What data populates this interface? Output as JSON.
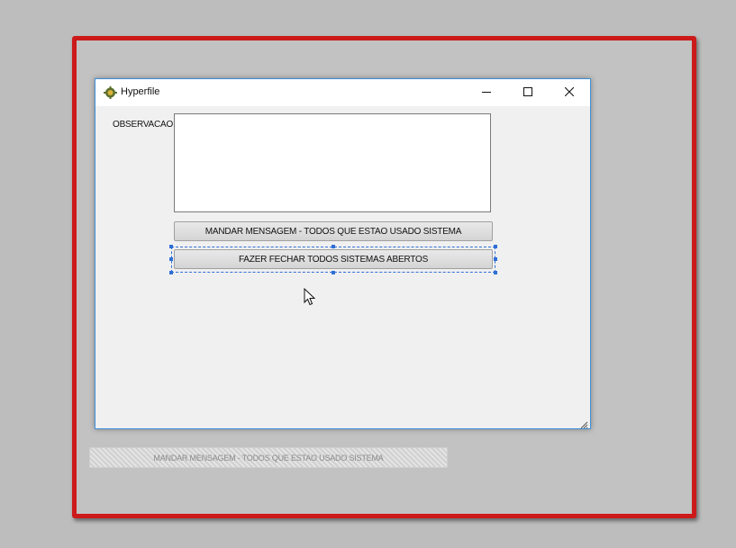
{
  "window": {
    "title": "Hyperfile"
  },
  "form": {
    "observation_label": "OBSERVACAO",
    "observation_value": "",
    "send_button_label": "MANDAR MENSAGEM - TODOS QUE ESTAO USADO SISTEMA",
    "close_all_button_label": "FAZER FECHAR TODOS SISTEMAS ABERTOS"
  },
  "drag_ghost": {
    "label": "MANDAR MENSAGEM - TODOS QUE ESTAO USADO SISTEMA"
  },
  "colors": {
    "highlight_frame": "#cc1a1a",
    "selection": "#2f6fd6",
    "window_border": "#3d8fd8"
  },
  "icons": {
    "app": "hyperfile-app-icon",
    "minimize": "minimize-icon",
    "maximize": "maximize-icon",
    "close": "close-icon",
    "resize": "resize-grip-icon",
    "cursor": "mouse-pointer-icon"
  }
}
